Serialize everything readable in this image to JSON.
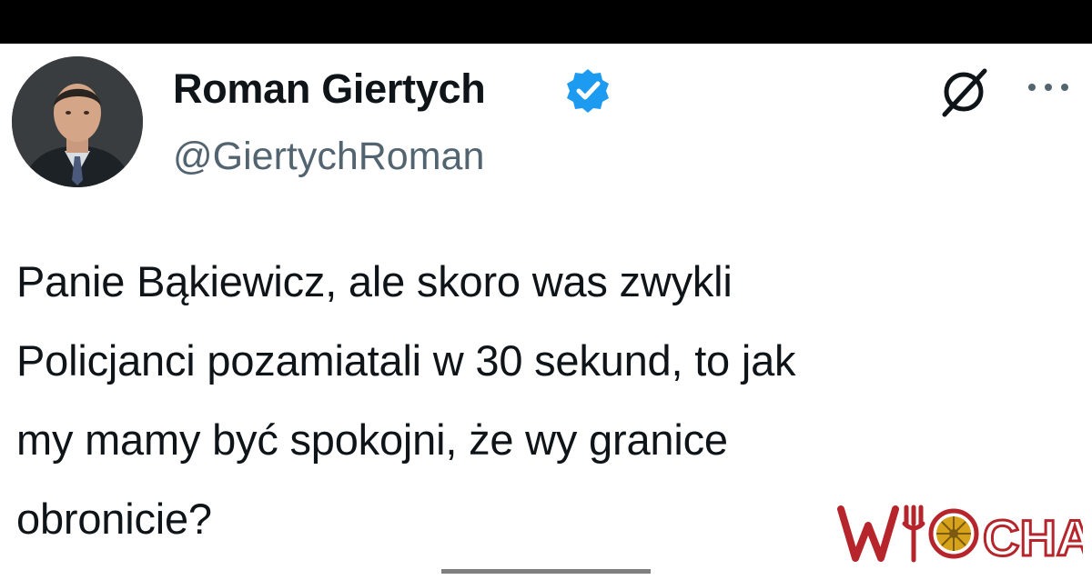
{
  "tweet": {
    "author": {
      "display_name": "Roman Giertych",
      "handle": "@GiertychRoman",
      "verified": true
    },
    "text_lines": [
      "Panie Bąkiewicz, ale skoro was zwykli",
      "Policjanci pozamiatali w 30 sekund, to jak",
      "my mamy być spokojni, że wy granice",
      "obronicie?"
    ]
  },
  "icons": {
    "verified": "verified-badge-icon",
    "grok": "grok-icon",
    "more": "more-options-icon"
  },
  "watermark": {
    "brand": "WIOCHA"
  },
  "colors": {
    "verified_blue": "#1d9bf0",
    "text": "#0f1419",
    "secondary_text": "#536471",
    "watermark_red": "#b5252b",
    "watermark_gold": "#d7a21b"
  }
}
